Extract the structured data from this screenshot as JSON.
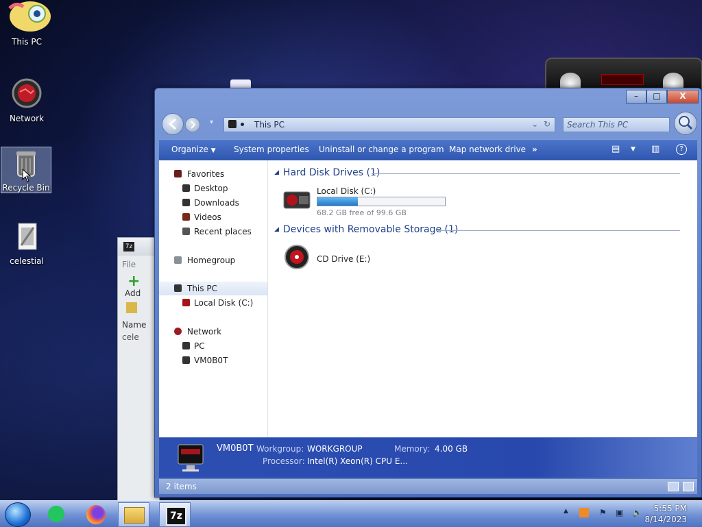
{
  "desktop": {
    "icons": [
      {
        "label": "This PC"
      },
      {
        "label": "Network"
      },
      {
        "label": "Recycle Bin"
      },
      {
        "label": "celestial"
      }
    ]
  },
  "zip_window": {
    "menu_file": "File",
    "add_label": "Add",
    "col_name": "Name",
    "row1": "cele"
  },
  "explorer": {
    "caption_buttons": {
      "minimize": "–",
      "maximize": "□",
      "close": "X"
    },
    "address": "This PC",
    "search_placeholder": "Search This PC",
    "toolbar": {
      "organize": "Organize",
      "system_properties": "System properties",
      "uninstall": "Uninstall or change a program",
      "map_drive": "Map network drive",
      "more": "»"
    },
    "sidebar": {
      "favorites": "Favorites",
      "desktop": "Desktop",
      "downloads": "Downloads",
      "videos": "Videos",
      "recent": "Recent places",
      "homegroup": "Homegroup",
      "this_pc": "This PC",
      "local_disk": "Local Disk (C:)",
      "network": "Network",
      "pc": "PC",
      "vm": "VM0B0T"
    },
    "groups": {
      "hdd": "Hard Disk Drives (1)",
      "removable": "Devices with Removable Storage (1)"
    },
    "drives": {
      "c_label": "Local Disk (C:)",
      "c_free": "68.2 GB free of 99.6 GB",
      "c_used_fraction": 0.315,
      "cd_label": "CD Drive (E:)"
    },
    "details": {
      "name": "VM0B0T",
      "workgroup_key": "Workgroup:",
      "workgroup_val": "WORKGROUP",
      "memory_key": "Memory:",
      "memory_val": "4.00 GB",
      "processor_key": "Processor:",
      "processor_val": "Intel(R) Xeon(R) CPU E..."
    },
    "status": {
      "count": "2 items"
    }
  },
  "taskbar": {
    "time": "5:55 PM",
    "date": "8/14/2023",
    "zip_label": "7z"
  }
}
